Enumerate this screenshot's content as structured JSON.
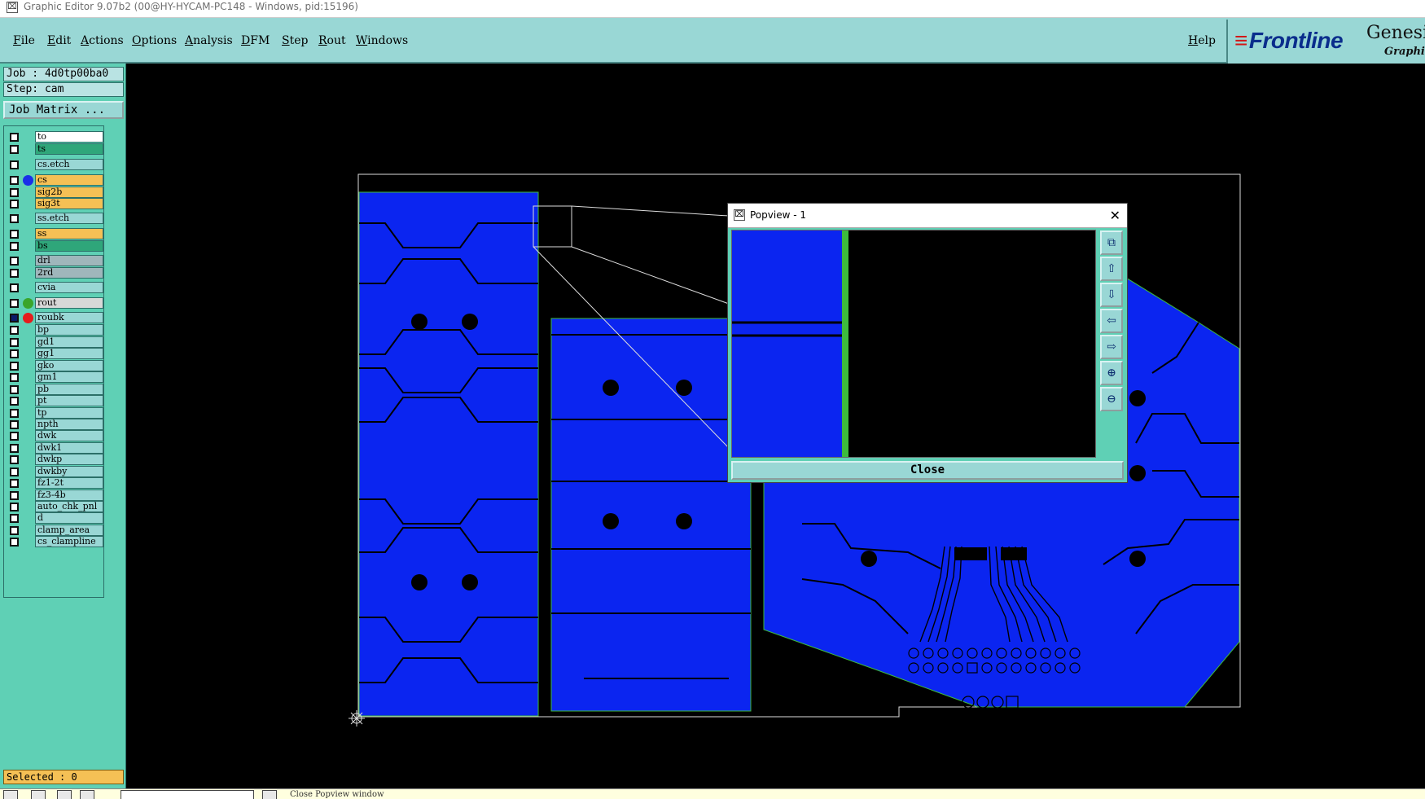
{
  "window_title": "Graphic Editor 9.07b2 (00@HY-HYCAM-PC148 - Windows, pid:15196)",
  "menu": [
    "File",
    "Edit",
    "Actions",
    "Options",
    "Analysis",
    "DFM",
    "Step",
    "Rout",
    "Windows"
  ],
  "help_label": "Help",
  "logo": {
    "brand": "Frontline",
    "product": "Genesis",
    "subtitle": "Graphic"
  },
  "job": {
    "job_label": "Job : 4d0tp00ba0",
    "step_label": "Step: cam",
    "matrix_button": "Job Matrix ..."
  },
  "layers": [
    {
      "name": "to",
      "color": "#ffffff",
      "dot": ""
    },
    {
      "name": "ts",
      "color": "#2fa67a",
      "dot": ""
    },
    {
      "name": "cs.etch",
      "color": "#99d7d5",
      "dot": ""
    },
    {
      "name": "cs",
      "color": "#f5c055",
      "dot": "#1a2ee8"
    },
    {
      "name": "sig2b",
      "color": "#f5c055",
      "dot": ""
    },
    {
      "name": "sig3t",
      "color": "#f5c055",
      "dot": ""
    },
    {
      "name": "ss.etch",
      "color": "#99d7d5",
      "dot": ""
    },
    {
      "name": "ss",
      "color": "#f5c055",
      "dot": ""
    },
    {
      "name": "bs",
      "color": "#2fa67a",
      "dot": ""
    },
    {
      "name": "drl",
      "color": "#9fb6bb",
      "dot": ""
    },
    {
      "name": "2rd",
      "color": "#9fb6bb",
      "dot": ""
    },
    {
      "name": "cvia",
      "color": "#99d7d5",
      "dot": ""
    },
    {
      "name": "rout",
      "color": "#d8d8d8",
      "dot": "#3aa52b"
    },
    {
      "name": "roubk",
      "color": "#99d7d5",
      "dot": "#e61c1c"
    },
    {
      "name": "bp",
      "color": "#99d7d5",
      "dot": ""
    },
    {
      "name": "gd1",
      "color": "#99d7d5",
      "dot": ""
    },
    {
      "name": "gg1",
      "color": "#99d7d5",
      "dot": ""
    },
    {
      "name": "gko",
      "color": "#99d7d5",
      "dot": ""
    },
    {
      "name": "gm1",
      "color": "#99d7d5",
      "dot": ""
    },
    {
      "name": "pb",
      "color": "#99d7d5",
      "dot": ""
    },
    {
      "name": "pt",
      "color": "#99d7d5",
      "dot": ""
    },
    {
      "name": "tp",
      "color": "#99d7d5",
      "dot": ""
    },
    {
      "name": "npth",
      "color": "#99d7d5",
      "dot": ""
    },
    {
      "name": "dwk",
      "color": "#99d7d5",
      "dot": ""
    },
    {
      "name": "dwk1",
      "color": "#99d7d5",
      "dot": ""
    },
    {
      "name": "dwkp",
      "color": "#99d7d5",
      "dot": ""
    },
    {
      "name": "dwkby",
      "color": "#99d7d5",
      "dot": ""
    },
    {
      "name": "fz1-2t",
      "color": "#99d7d5",
      "dot": ""
    },
    {
      "name": "fz3-4b",
      "color": "#99d7d5",
      "dot": ""
    },
    {
      "name": "auto_chk_pnl",
      "color": "#99d7d5",
      "dot": ""
    },
    {
      "name": "d",
      "color": "#99d7d5",
      "dot": ""
    },
    {
      "name": "clamp_area",
      "color": "#99d7d5",
      "dot": ""
    },
    {
      "name": "cs_clampline",
      "color": "#99d7d5",
      "dot": ""
    }
  ],
  "selected_label": "Selected : 0",
  "popview": {
    "title": "Popview - 1",
    "close_label": "Close",
    "tools": [
      "zoom-fit-icon",
      "pan-up-icon",
      "pan-down-icon",
      "pan-left-icon",
      "pan-right-icon",
      "zoom-in-icon",
      "zoom-out-icon"
    ]
  },
  "status_message": "Close Popview window",
  "colors": {
    "copper": "#0b25f0",
    "menu_bg": "#99d7d5",
    "panel_bg": "#5fd0b5",
    "highlight": "#f5c055",
    "outline": "#3dbb3d"
  }
}
